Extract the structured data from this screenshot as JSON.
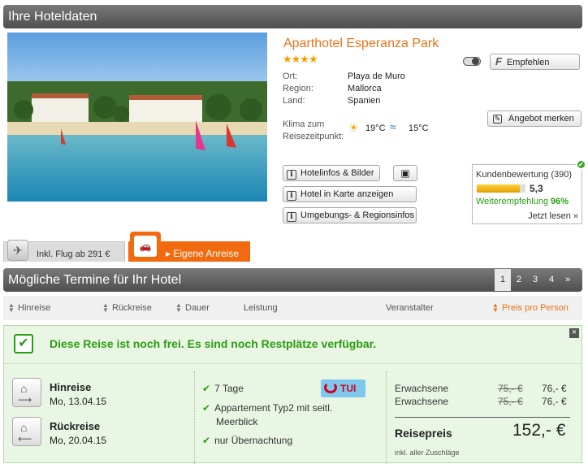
{
  "header": {
    "title": "Ihre Hoteldaten"
  },
  "hotel": {
    "name": "Aparthotel Esperanza Park",
    "stars": "★★★★",
    "ort_label": "Ort:",
    "ort": "Playa de Muro",
    "region_label": "Region:",
    "region": "Mallorca",
    "land_label": "Land:",
    "land": "Spanien",
    "klima_label_1": "Klima zum",
    "klima_label_2": "Reisezeitpunkt:",
    "air_temp": "19°C",
    "water_temp": "15°C"
  },
  "buttons": {
    "empfehlen": "Empfehlen",
    "angebot_merken": "Angebot merken",
    "hotelinfos": "Hotelinfos & Bilder",
    "karte": "Hotel in Karte anzeigen",
    "umgebung": "Umgebungs- & Regionsinfos"
  },
  "rating": {
    "label": "Kundenbewertung (390)",
    "score": "5,3",
    "score_fraction": 0.88,
    "recommend_label": "Weiterempfehlung",
    "recommend_value": "96%",
    "read_now": "Jetzt lesen »"
  },
  "travel_tabs": {
    "flight": "Inkl. Flug ab 291 €",
    "own": "Eigene Anreise"
  },
  "dates_section": {
    "title": "Mögliche Termine für Ihr Hotel",
    "pages": [
      "1",
      "2",
      "3",
      "4",
      "»"
    ],
    "columns": {
      "hinreise": "Hinreise",
      "rueckreise": "Rückreise",
      "dauer": "Dauer",
      "leistung": "Leistung",
      "veranstalter": "Veranstalter",
      "preis": "Preis pro Person"
    }
  },
  "offer": {
    "availability": "Diese Reise ist noch frei. Es sind noch Restplätze verfügbar.",
    "close": "×",
    "hinreise_label": "Hinreise",
    "hinreise_date": "Mo, 13.04.15",
    "rueckreise_label": "Rückreise",
    "rueckreise_date": "Mo, 20.04.15",
    "features": [
      "7 Tage",
      "Appartement Typ2 mit seitl.",
      "Meerblick",
      "nur Übernachtung"
    ],
    "operator": "TUI",
    "price_rows": [
      {
        "label": "Erwachsene",
        "old": "75,- €",
        "new": "76,- €"
      },
      {
        "label": "Erwachsene",
        "old": "75,- €",
        "new": "76,- €"
      }
    ],
    "total_label": "Reisepreis",
    "total": "152,- €",
    "note": "inkl. aller Zuschläge"
  }
}
